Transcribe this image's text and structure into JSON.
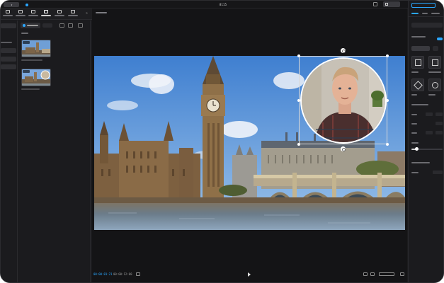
{
  "app": {
    "project_title": "",
    "window_title": "8115",
    "menu_label": ""
  },
  "player": {
    "timecode_current": "00:00:01:21",
    "timecode_total": "00:00:12:00",
    "progress_ratio": 0.14
  },
  "right_panel": {
    "opacity_ratio": 0.15
  },
  "colors": {
    "accent": "#2aa7ff",
    "background": "#1b1b1e",
    "panel": "#141416"
  }
}
